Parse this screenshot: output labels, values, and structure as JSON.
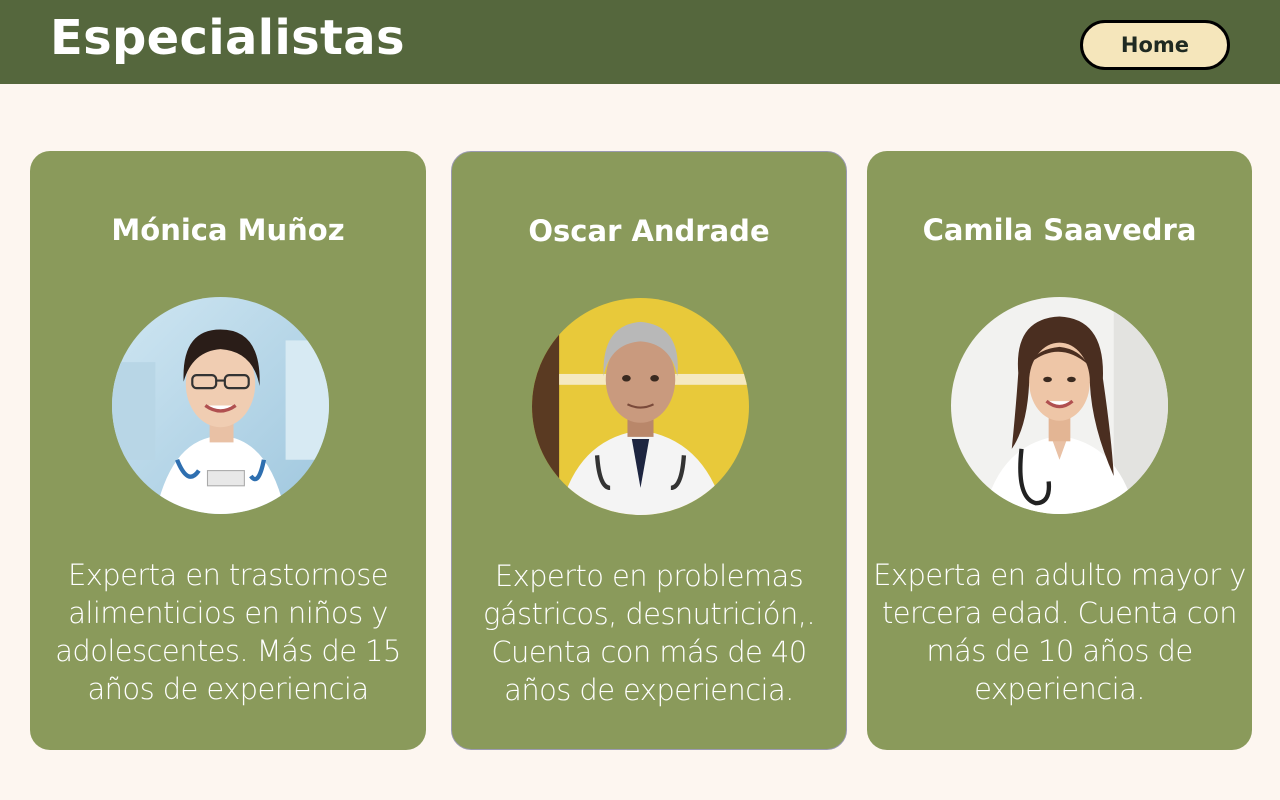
{
  "header": {
    "title": "Especialistas",
    "home_label": "Home"
  },
  "specialists": [
    {
      "name": "Mónica Muñoz",
      "description": "Experta en trastornose alimenticios en niños y adolescentes. Más de 15 años de experiencia",
      "photo_icon": "female-doctor-photo"
    },
    {
      "name": "Oscar Andrade",
      "description": "Experto en problemas gástricos, desnutrición,. Cuenta con más de 40 años de experiencia.",
      "photo_icon": "male-doctor-photo"
    },
    {
      "name": "Camila Saavedra",
      "description": "Experta en adulto mayor y tercera edad. Cuenta con más de 10 años de experiencia.",
      "photo_icon": "female-doctor-photo"
    }
  ],
  "colors": {
    "header_bg": "#55673d",
    "page_bg": "#fdf6f0",
    "card_bg": "#8a9a5b",
    "button_bg": "#f5e6bb"
  }
}
